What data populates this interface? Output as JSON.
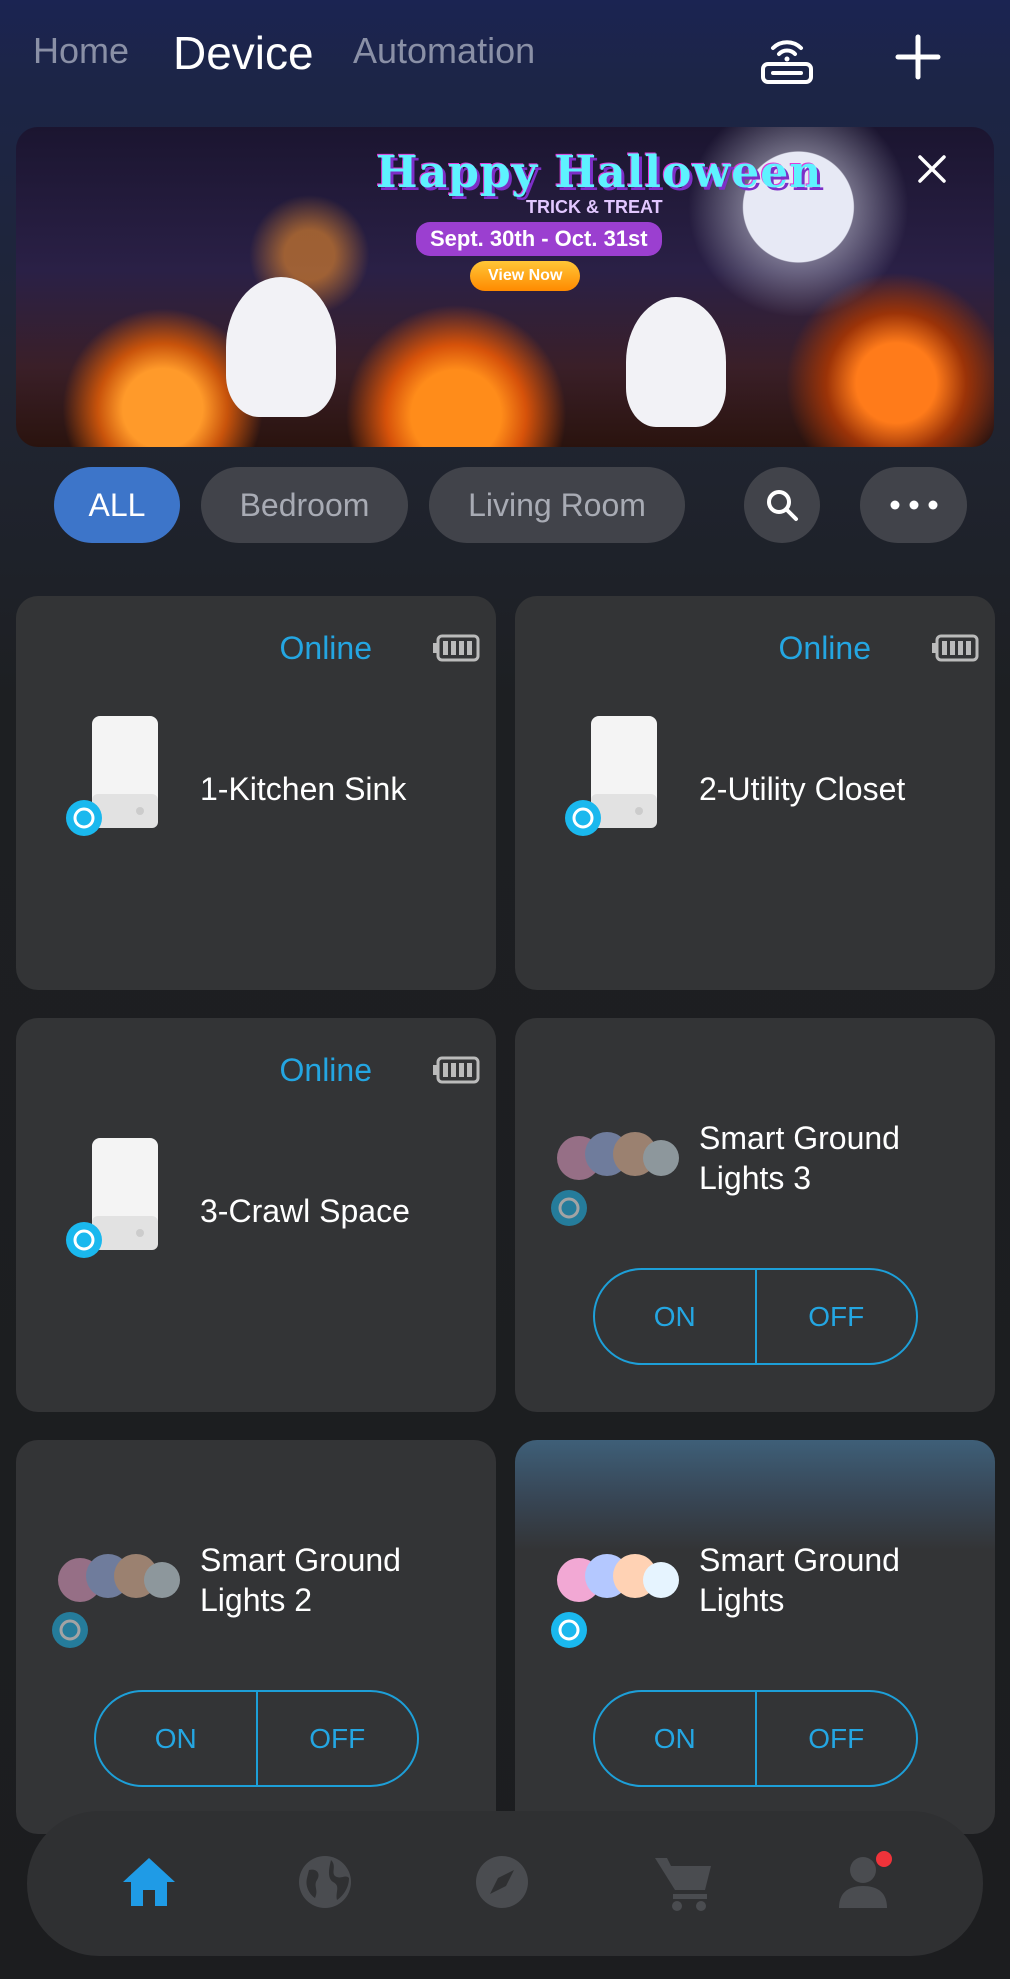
{
  "header": {
    "tabs": [
      {
        "label": "Home"
      },
      {
        "label": "Device"
      },
      {
        "label": "Automation"
      }
    ],
    "icons": {
      "gateway": "gateway-icon",
      "add": "plus-icon"
    }
  },
  "banner": {
    "title": "Happy Halloween",
    "subtitle": "TRICK & TREAT",
    "dates": "Sept. 30th - Oct. 31st",
    "button": "View Now"
  },
  "filters": {
    "chips": [
      "ALL",
      "Bedroom",
      "Living Room"
    ],
    "active_color": "#3d75c9"
  },
  "devices": [
    {
      "name": "1-Kitchen Sink",
      "status": "Online",
      "type": "sensor"
    },
    {
      "name": "2-Utility Closet",
      "status": "Online",
      "type": "sensor"
    },
    {
      "name": "3-Crawl Space",
      "status": "Online",
      "type": "sensor"
    },
    {
      "name": "Smart Ground Lights 3",
      "type": "light",
      "on_label": "ON",
      "off_label": "OFF"
    },
    {
      "name": "Smart Ground Lights 2",
      "type": "light",
      "on_label": "ON",
      "off_label": "OFF"
    },
    {
      "name": "Smart Ground Lights",
      "type": "light",
      "on_label": "ON",
      "off_label": "OFF"
    }
  ],
  "colors": {
    "accent": "#24a6e2",
    "card": "#333436",
    "notification": "#f0333a"
  },
  "bottom_nav": [
    "home-icon",
    "globe-icon",
    "compass-icon",
    "cart-icon",
    "user-icon"
  ]
}
